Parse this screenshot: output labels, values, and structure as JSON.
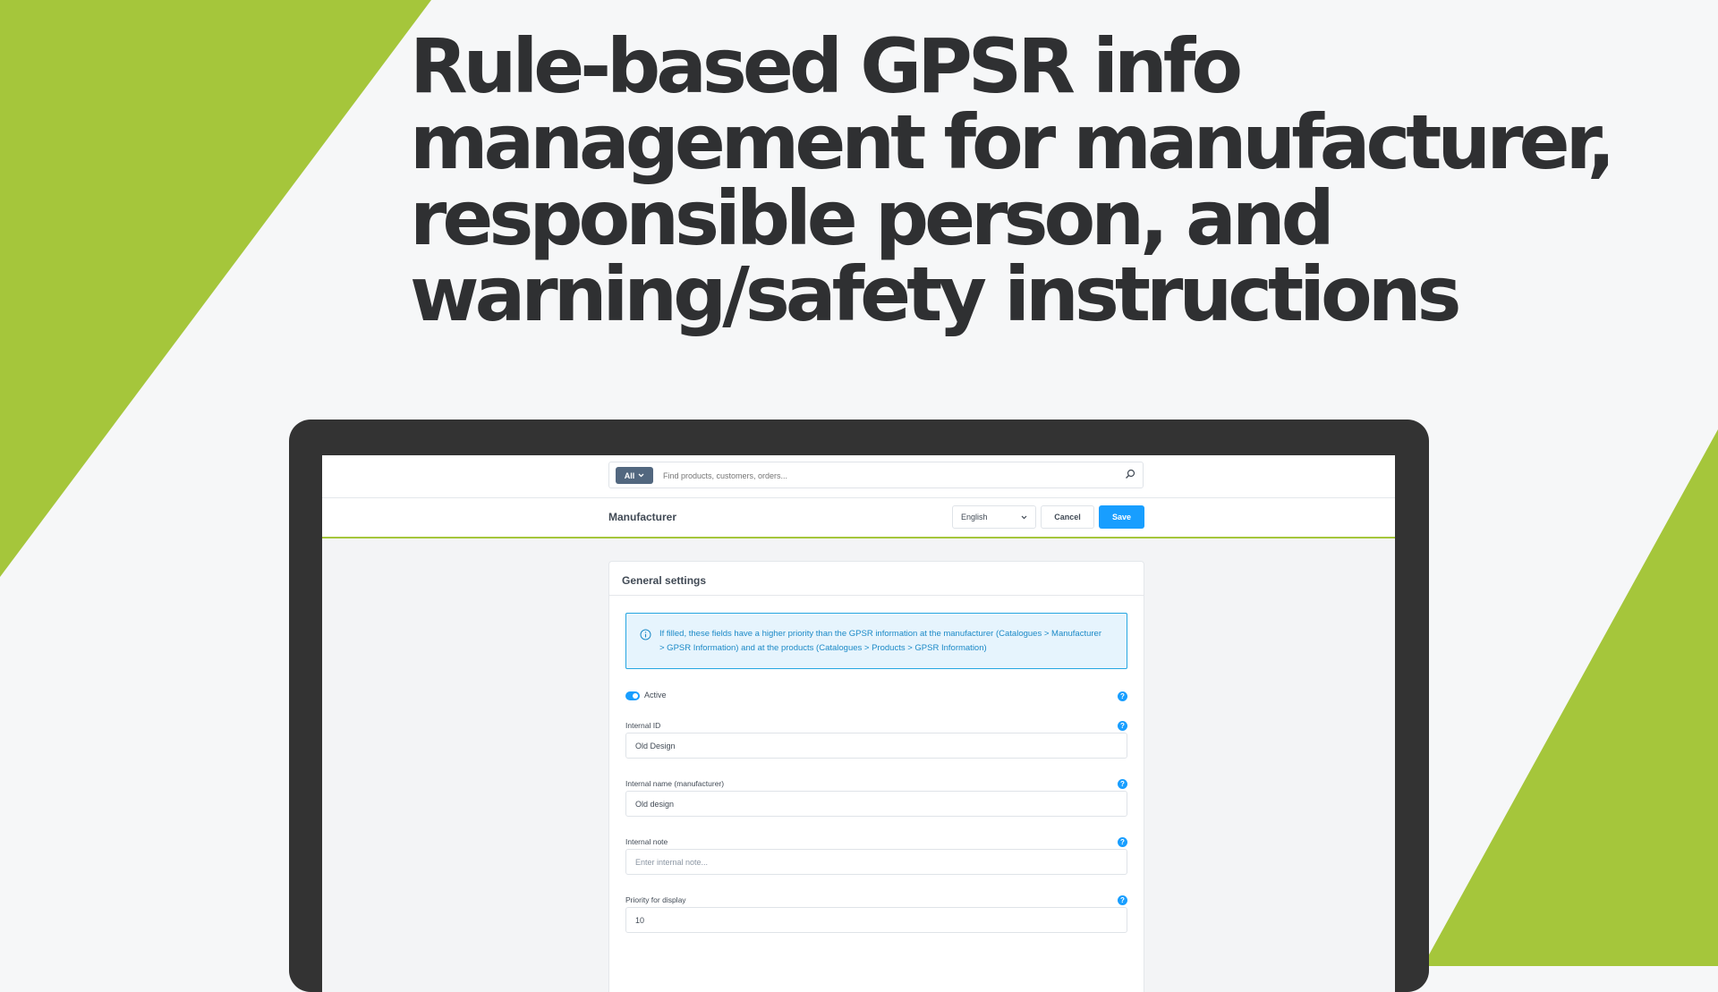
{
  "colors": {
    "brand_green": "#a5c63b",
    "headline": "#2f3032",
    "laptop_frame": "#333333",
    "primary_button": "#189eff",
    "info_border": "#26a6e1",
    "info_background": "#e6f4fd"
  },
  "headline": {
    "line1": "Rule-based GPSR info",
    "line2": "management for manufacturer,",
    "line3": "responsible person, and",
    "line4": "warning/safety instructions"
  },
  "search": {
    "scope_label": "All",
    "placeholder": "Find products, customers, orders...",
    "icon": "search-icon"
  },
  "toolbar": {
    "page_title": "Manufacturer",
    "language_value": "English",
    "cancel_label": "Cancel",
    "save_label": "Save"
  },
  "card": {
    "title": "General settings",
    "info_icon": "info-circle-icon",
    "info_text": "If filled, these fields have a higher priority than the GPSR information at the manufacturer (Catalogues > Manufacturer > GPSR Information) and at the products (Catalogues > Products > GPSR Information)",
    "active": {
      "label": "Active",
      "checked": true
    },
    "help_icon": "?",
    "fields": {
      "internal_id": {
        "label": "Internal ID",
        "value": "Old Design",
        "placeholder": ""
      },
      "internal_name": {
        "label": "Internal name (manufacturer)",
        "value": "Old design",
        "placeholder": ""
      },
      "internal_note": {
        "label": "Internal note",
        "value": "",
        "placeholder": "Enter internal note..."
      },
      "priority": {
        "label": "Priority for display",
        "value": "10",
        "placeholder": ""
      }
    }
  }
}
